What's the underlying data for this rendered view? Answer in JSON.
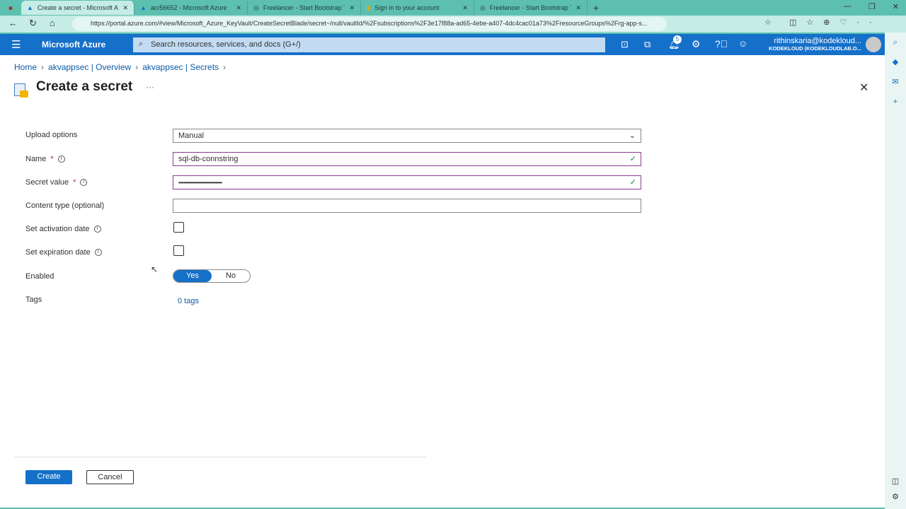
{
  "browser": {
    "tabs": [
      {
        "label": "Create a secret - Microsoft Azure",
        "active": true
      },
      {
        "label": "acr56652 - Microsoft Azure"
      },
      {
        "label": "Freelancer - Start Bootstrap Theme"
      },
      {
        "label": "Sign in to your account"
      },
      {
        "label": "Freelancer - Start Bootstrap Theme"
      }
    ],
    "url": "https://portal.azure.com/#view/Microsoft_Azure_KeyVault/CreateSecretBlade/secret~/null/vaultId/%2Fsubscriptions%2F3e17f88a-ad65-4ebe-a407-4dc4cac01a73%2FresourceGroups%2Frg-app-s..."
  },
  "header": {
    "brand": "Microsoft Azure",
    "search_placeholder": "Search resources, services, and docs (G+/)",
    "notifications": "5",
    "user": "rithinskaria@kodekloud...",
    "tenant": "KODEKLOUD (KODEKLOUDLAB.O..."
  },
  "breadcrumb": [
    "Home",
    "akvappsec | Overview",
    "akvappsec | Secrets"
  ],
  "page": {
    "title": "Create a secret",
    "more": "···"
  },
  "form": {
    "upload_label": "Upload options",
    "upload_value": "Manual",
    "name_label": "Name",
    "name_value": "sql-db-connstring",
    "secret_label": "Secret value",
    "secret_value": "••••••••••••••••••••••••••••••••••",
    "content_label": "Content type (optional)",
    "content_value": "",
    "activation_label": "Set activation date",
    "activation_checked": false,
    "expiration_label": "Set expiration date",
    "expiration_checked": false,
    "enabled_label": "Enabled",
    "enabled_yes": "Yes",
    "enabled_no": "No",
    "enabled": "Yes",
    "tags_label": "Tags",
    "tags_value": "0 tags",
    "required": "*"
  },
  "actions": {
    "create": "Create",
    "cancel": "Cancel"
  },
  "colors": {
    "accent": "#1570c9",
    "browser": "#5dbfb0"
  }
}
